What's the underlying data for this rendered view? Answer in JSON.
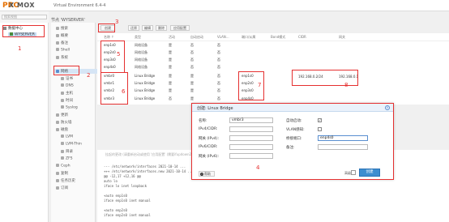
{
  "header": {
    "logo_prox": "PRO",
    "logo_rest": "X MOX",
    "version": "Virtual Environment 6.4-4"
  },
  "left_search": {
    "placeholder": "搜索视图"
  },
  "tree": [
    {
      "label": "数据中心"
    },
    {
      "label": "WYSERVER"
    }
  ],
  "node_title": "节点 'WYSERVER'",
  "menu": [
    {
      "label": "搜索"
    },
    {
      "label": "概要"
    },
    {
      "label": "备注"
    },
    {
      "label": "Shell"
    },
    {
      "label": "系统"
    },
    {
      "label": "网络"
    },
    {
      "label": "证书"
    },
    {
      "label": "DNS"
    },
    {
      "label": "主机"
    },
    {
      "label": "时间"
    },
    {
      "label": "Syslog"
    },
    {
      "label": "更新"
    },
    {
      "label": "防火墙"
    },
    {
      "label": "磁盘"
    },
    {
      "label": "LVM"
    },
    {
      "label": "LVM-Thin"
    },
    {
      "label": "目录"
    },
    {
      "label": "ZFS"
    },
    {
      "label": "Ceph"
    },
    {
      "label": "复制"
    },
    {
      "label": "任务历史"
    },
    {
      "label": "订阅"
    }
  ],
  "toolbar": {
    "create": "创建",
    "revert": "还原",
    "edit": "编辑",
    "delete": "删除",
    "apply": "应用配置"
  },
  "table": {
    "headers": [
      "名称 ↑",
      "类型",
      "活动",
      "自动启动",
      "VLAN...",
      "端口/从属",
      "Bond模式",
      "CIDR",
      "网关"
    ],
    "rows": [
      {
        "name": "enp1s0",
        "type": "网络设备",
        "active": "是",
        "auto": "否",
        "vlan": "否",
        "ports": "",
        "cidr": "",
        "gw": ""
      },
      {
        "name": "enp2s0",
        "type": "网络设备",
        "active": "是",
        "auto": "否",
        "vlan": "否",
        "ports": "",
        "cidr": "",
        "gw": ""
      },
      {
        "name": "enp3s0",
        "type": "网络设备",
        "active": "是",
        "auto": "否",
        "vlan": "否",
        "ports": "",
        "cidr": "",
        "gw": ""
      },
      {
        "name": "enp4s0",
        "type": "网络设备",
        "active": "是",
        "auto": "否",
        "vlan": "否",
        "ports": "",
        "cidr": "",
        "gw": ""
      },
      {
        "name": "vmbr0",
        "type": "Linux Bridge",
        "active": "是",
        "auto": "是",
        "vlan": "否",
        "ports": "enp1s0",
        "cidr": "192.168.0.2/24",
        "gw": "192.168.0.1"
      },
      {
        "name": "vmbr1",
        "type": "Linux Bridge",
        "active": "是",
        "auto": "是",
        "vlan": "否",
        "ports": "enp2s0",
        "cidr": "",
        "gw": ""
      },
      {
        "name": "vmbr2",
        "type": "Linux Bridge",
        "active": "是",
        "auto": "是",
        "vlan": "否",
        "ports": "enp3s0",
        "cidr": "",
        "gw": ""
      },
      {
        "name": "vmbr3",
        "type": "Linux Bridge",
        "active": "否",
        "auto": "是",
        "vlan": "否",
        "ports": "enp4s0",
        "cidr": "",
        "gw": ""
      }
    ]
  },
  "info_text": "挂起的更改 (请重新启动或使用 '应用配置' (需要ifupdown2) 来激活)",
  "code_lines": [
    "--- /etc/network/interfaces   2021-10-14 ...",
    "+++ /etc/network/interfaces.new   2021-10-14 ...",
    "@@ -12,17 +12,16 @@",
    " auto lo",
    " iface lo inet loopback",
    "",
    "+auto enp1s0",
    " iface enp1s0 inet manual",
    "",
    "+auto enp2s0",
    " iface enp2s0 inet manual"
  ],
  "dialog": {
    "title": "创建: Linux Bridge",
    "close_glyph": "×",
    "left_labels": [
      "名称:",
      "IPv4/CIDR:",
      "网关 (IPv4):",
      "IPv6/CIDR:",
      "网关 (IPv6):"
    ],
    "name_value": "vmbr3",
    "right_labels": [
      "自动启动:",
      "VLAN感知:",
      "桥接端口:",
      "备注:"
    ],
    "autostart_checked": "✓",
    "bridge_ports_value": "enp4s0",
    "help_label": "帮助",
    "help_glyph": "?",
    "advanced_label": "高级",
    "create_label": "创建"
  },
  "annotations": [
    "1",
    "2",
    "3",
    "4",
    "5",
    "6",
    "7",
    "8"
  ],
  "colors": {
    "annotation_red": "#e53030",
    "accent_blue": "#3e8ed0",
    "logo_orange": "#e57000"
  }
}
